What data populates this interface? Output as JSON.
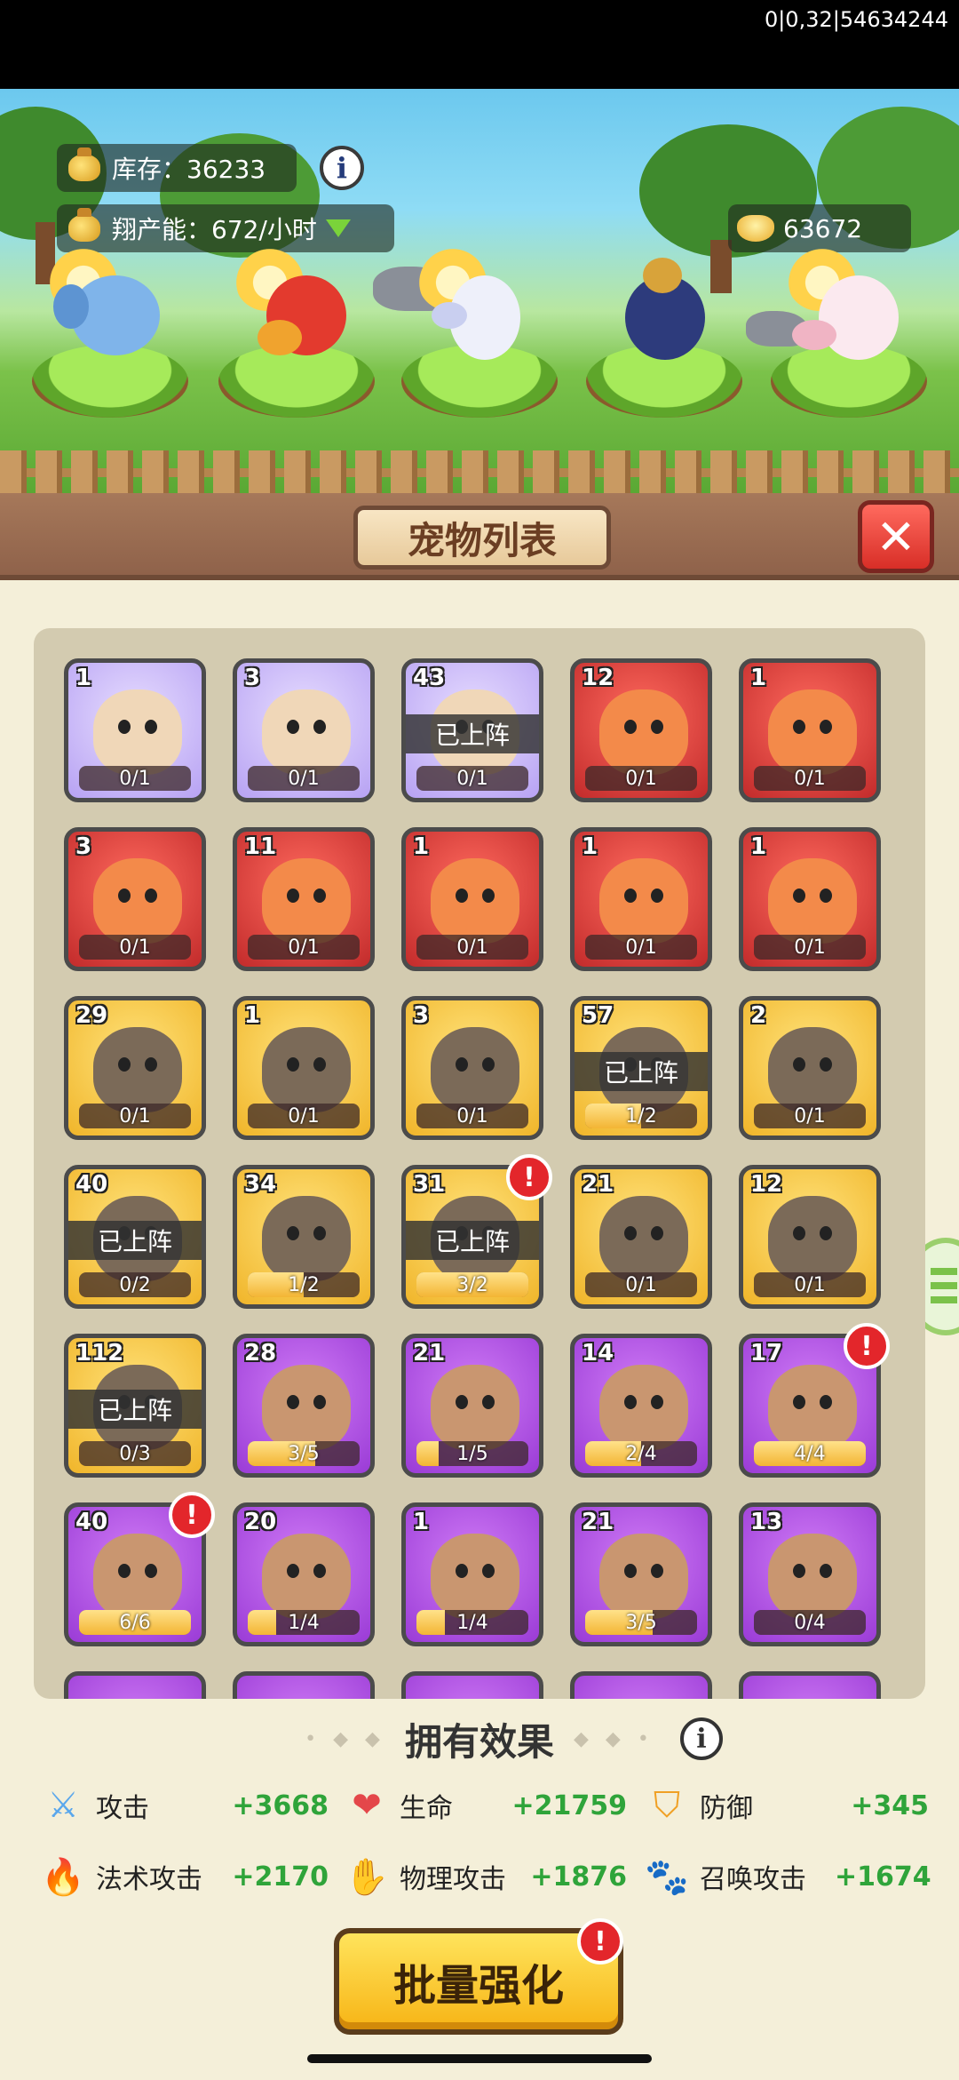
{
  "status_bar": {
    "text": "0|0,32|54634244"
  },
  "resources": {
    "stock_label": "库存：36233",
    "production_label": "翔产能：672/小时",
    "gold": "63672"
  },
  "deployed_pets": [
    "elephant",
    "red-fish",
    "winged-unicorn",
    "eagle-warrior",
    "white-fox"
  ],
  "panel": {
    "title": "宠物列表",
    "deploy_tag": "已上阵"
  },
  "pets": [
    {
      "level": "1",
      "progress": "0/1",
      "rarity": "light-purple",
      "deployed": false,
      "alert": false,
      "fill": 0
    },
    {
      "level": "3",
      "progress": "0/1",
      "rarity": "light-purple",
      "deployed": false,
      "alert": false,
      "fill": 0
    },
    {
      "level": "43",
      "progress": "0/1",
      "rarity": "light-purple",
      "deployed": true,
      "alert": false,
      "fill": 0
    },
    {
      "level": "12",
      "progress": "0/1",
      "rarity": "red",
      "deployed": false,
      "alert": false,
      "fill": 0
    },
    {
      "level": "1",
      "progress": "0/1",
      "rarity": "red",
      "deployed": false,
      "alert": false,
      "fill": 0
    },
    {
      "level": "3",
      "progress": "0/1",
      "rarity": "red",
      "deployed": false,
      "alert": false,
      "fill": 0
    },
    {
      "level": "11",
      "progress": "0/1",
      "rarity": "red",
      "deployed": false,
      "alert": false,
      "fill": 0
    },
    {
      "level": "1",
      "progress": "0/1",
      "rarity": "red",
      "deployed": false,
      "alert": false,
      "fill": 0
    },
    {
      "level": "1",
      "progress": "0/1",
      "rarity": "red",
      "deployed": false,
      "alert": false,
      "fill": 0
    },
    {
      "level": "1",
      "progress": "0/1",
      "rarity": "red",
      "deployed": false,
      "alert": false,
      "fill": 0
    },
    {
      "level": "29",
      "progress": "0/1",
      "rarity": "gold",
      "deployed": false,
      "alert": false,
      "fill": 0
    },
    {
      "level": "1",
      "progress": "0/1",
      "rarity": "gold",
      "deployed": false,
      "alert": false,
      "fill": 0
    },
    {
      "level": "3",
      "progress": "0/1",
      "rarity": "gold",
      "deployed": false,
      "alert": false,
      "fill": 0
    },
    {
      "level": "57",
      "progress": "1/2",
      "rarity": "gold",
      "deployed": true,
      "alert": false,
      "fill": 0.5
    },
    {
      "level": "2",
      "progress": "0/1",
      "rarity": "gold",
      "deployed": false,
      "alert": false,
      "fill": 0
    },
    {
      "level": "40",
      "progress": "0/2",
      "rarity": "gold",
      "deployed": true,
      "alert": false,
      "fill": 0
    },
    {
      "level": "34",
      "progress": "1/2",
      "rarity": "gold",
      "deployed": false,
      "alert": false,
      "fill": 0.5
    },
    {
      "level": "31",
      "progress": "3/2",
      "rarity": "gold",
      "deployed": true,
      "alert": true,
      "fill": 1
    },
    {
      "level": "21",
      "progress": "0/1",
      "rarity": "gold",
      "deployed": false,
      "alert": false,
      "fill": 0
    },
    {
      "level": "12",
      "progress": "0/1",
      "rarity": "gold",
      "deployed": false,
      "alert": false,
      "fill": 0
    },
    {
      "level": "112",
      "progress": "0/3",
      "rarity": "gold",
      "deployed": true,
      "alert": false,
      "fill": 0
    },
    {
      "level": "28",
      "progress": "3/5",
      "rarity": "purple",
      "deployed": false,
      "alert": false,
      "fill": 0.6
    },
    {
      "level": "21",
      "progress": "1/5",
      "rarity": "purple",
      "deployed": false,
      "alert": false,
      "fill": 0.2
    },
    {
      "level": "14",
      "progress": "2/4",
      "rarity": "purple",
      "deployed": false,
      "alert": false,
      "fill": 0.5
    },
    {
      "level": "17",
      "progress": "4/4",
      "rarity": "purple",
      "deployed": false,
      "alert": true,
      "fill": 1
    },
    {
      "level": "40",
      "progress": "6/6",
      "rarity": "purple",
      "deployed": false,
      "alert": true,
      "fill": 1
    },
    {
      "level": "20",
      "progress": "1/4",
      "rarity": "purple",
      "deployed": false,
      "alert": false,
      "fill": 0.25
    },
    {
      "level": "1",
      "progress": "1/4",
      "rarity": "purple",
      "deployed": false,
      "alert": false,
      "fill": 0.25
    },
    {
      "level": "21",
      "progress": "3/5",
      "rarity": "purple",
      "deployed": false,
      "alert": false,
      "fill": 0.6
    },
    {
      "level": "13",
      "progress": "0/4",
      "rarity": "purple",
      "deployed": false,
      "alert": false,
      "fill": 0
    }
  ],
  "effects": {
    "title": "拥有效果",
    "stats": [
      {
        "label": "攻击",
        "value": "+3668",
        "icon": "sword-icon"
      },
      {
        "label": "生命",
        "value": "+21759",
        "icon": "heart-icon"
      },
      {
        "label": "防御",
        "value": "+345",
        "icon": "shield-icon"
      },
      {
        "label": "法术攻击",
        "value": "+2170",
        "icon": "fire-icon"
      },
      {
        "label": "物理攻击",
        "value": "+1876",
        "icon": "claw-icon"
      },
      {
        "label": "召唤攻击",
        "value": "+1674",
        "icon": "paw-icon"
      }
    ]
  },
  "actions": {
    "batch_enhance": "批量强化"
  },
  "colors": {
    "stat_value": "#2fa43a",
    "alert": "#e3262b"
  }
}
